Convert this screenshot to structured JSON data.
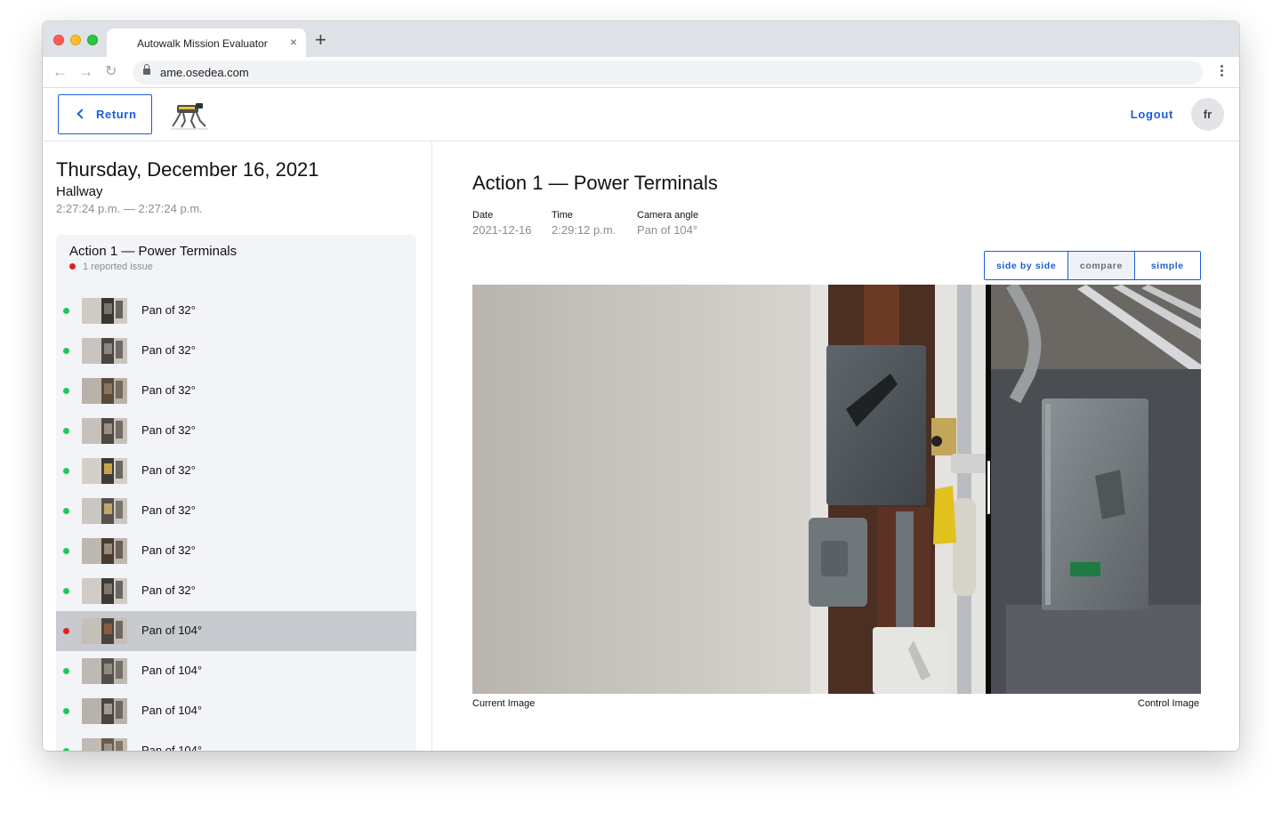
{
  "browser": {
    "tab_title": "Autowalk Mission Evaluator",
    "close_glyph": "×",
    "newtab_glyph": "+",
    "url": "ame.osedea.com",
    "back_glyph": "←",
    "forward_glyph": "→",
    "reload_glyph": "↻"
  },
  "header": {
    "return_label": "Return",
    "logout_label": "Logout",
    "avatar_initials": "fr"
  },
  "sidebar": {
    "date": "Thursday, December 16, 2021",
    "location": "Hallway",
    "time_range": "2:27:24 p.m. — 2:27:24 p.m.",
    "action": {
      "title": "Action 1 — Power Terminals",
      "issue_text": "1 reported issue"
    },
    "items": [
      {
        "label": "Pan of 32°",
        "status": "ok"
      },
      {
        "label": "Pan of 32°",
        "status": "ok"
      },
      {
        "label": "Pan of 32°",
        "status": "ok"
      },
      {
        "label": "Pan of 32°",
        "status": "ok"
      },
      {
        "label": "Pan of 32°",
        "status": "ok"
      },
      {
        "label": "Pan of 32°",
        "status": "ok"
      },
      {
        "label": "Pan of 32°",
        "status": "ok"
      },
      {
        "label": "Pan of 32°",
        "status": "ok"
      },
      {
        "label": "Pan of 104°",
        "status": "issue",
        "selected": true
      },
      {
        "label": "Pan of 104°",
        "status": "ok"
      },
      {
        "label": "Pan of 104°",
        "status": "ok"
      },
      {
        "label": "Pan of 104°",
        "status": "ok"
      }
    ]
  },
  "main": {
    "title": "Action 1 — Power Terminals",
    "date_label": "Date",
    "date_value": "2021-12-16",
    "time_label": "Time",
    "time_value": "2:29:12 p.m.",
    "angle_label": "Camera angle",
    "angle_value": "Pan of 104°",
    "modes": [
      "side by side",
      "compare",
      "simple"
    ],
    "active_mode": "compare",
    "current_image_label": "Current Image",
    "control_image_label": "Control Image"
  },
  "colors": {
    "accent": "#1a5fd6",
    "ok": "#22c55e",
    "issue": "#e02020",
    "selected_row": "#c7cace"
  }
}
